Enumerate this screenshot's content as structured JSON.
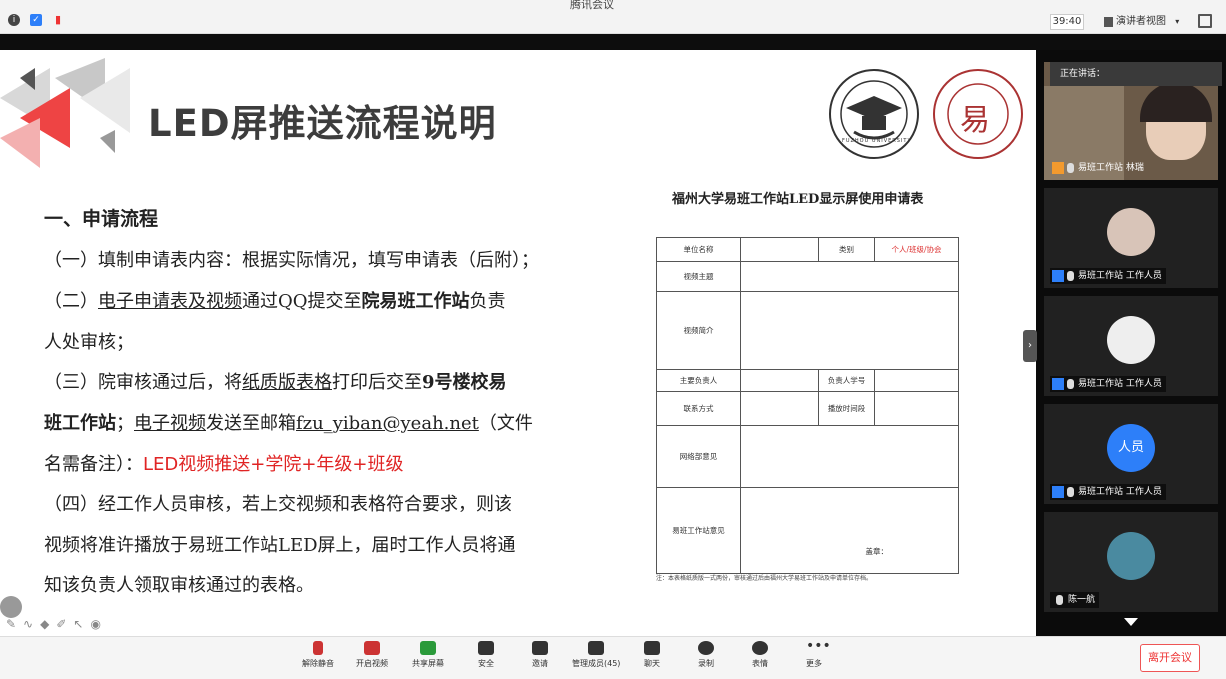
{
  "window": {
    "title": "腾讯会议"
  },
  "topbar": {
    "timer": "39:40",
    "presenter_view": "演讲者视图"
  },
  "slide": {
    "title": "LED屏推送流程说明",
    "section_heading": "一、申请流程",
    "line1": "（一）填制申请表内容：根据实际情况，填写申请表（后附）；",
    "line2_a": "（二）",
    "line2_b": "电子申请表及视频",
    "line2_c": "通过QQ提交至",
    "line2_d": "院易班工作站",
    "line2_e": "负责",
    "line3": "人处审核；",
    "line4_a": "（三）院审核通过后，将",
    "line4_b": "纸质版表格",
    "line4_c": "打印后交至",
    "line4_d": "9号楼校易",
    "line5_a": "班工作站",
    "line5_b": "；",
    "line5_c": "电子视频",
    "line5_d": "发送至邮箱",
    "line5_e": "fzu_yiban@yeah.net",
    "line5_f": "（文件",
    "line6_a": "名需备注）：",
    "line6_b": "LED视频推送+学院+年级+班级",
    "line7": "（四）经工作人员审核，若上交视频和表格符合要求，则该",
    "line8": "视频将准许播放于易班工作站LED屏上，届时工作人员将通",
    "line9": "知该负责人领取审核通过的表格。"
  },
  "logos": {
    "university": "FUZHOU UNIVERSITY",
    "yiban_char": "易"
  },
  "form": {
    "title": "福州大学易班工作站LED显示屏使用申请表",
    "unit_name": "单位名称",
    "category": "类别",
    "category_options": "个人/班级/协会",
    "video_topic": "视频主题",
    "video_intro": "视频简介",
    "main_person": "主要负责人",
    "person_id": "负责人学号",
    "contact": "联系方式",
    "play_time": "播放时间段",
    "network_opinion": "网络部意见",
    "yiban_opinion": "易班工作站意见",
    "seal": "盖章：",
    "note": "注：本表格纸质版一式两份，审核通过后由福州大学易班工作站及申请单位存档。"
  },
  "participants": {
    "speaking_label": "正在讲话：",
    "tiles": [
      {
        "name": "易班工作站 林瑞"
      },
      {
        "name": "易班工作站 工作人员"
      },
      {
        "name": "易班工作站 工作人员"
      },
      {
        "avatar_text": "人员",
        "name": "易班工作站 工作人员"
      },
      {
        "name": "陈一航"
      }
    ]
  },
  "toolbar": {
    "mute": "解除静音",
    "video": "开启视频",
    "share": "共享屏幕",
    "security": "安全",
    "invite": "邀请",
    "members": "管理成员(45)",
    "chat": "聊天",
    "record": "录制",
    "emoji": "表情",
    "more": "更多",
    "leave": "离开会议"
  },
  "colors": {
    "accent_red": "#e02424",
    "blue": "#2d7ff9",
    "panel_dark": "#0b0b0b"
  }
}
